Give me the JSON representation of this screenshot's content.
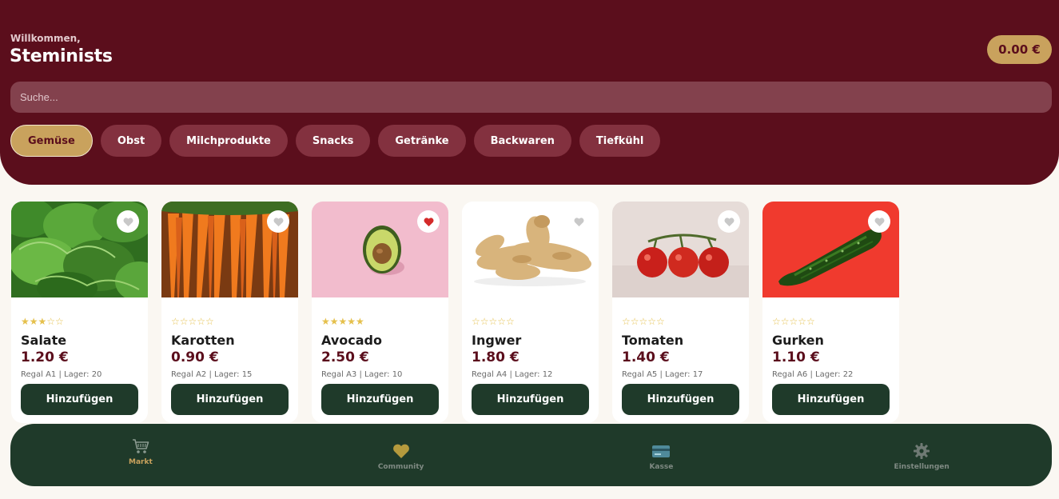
{
  "header": {
    "welcome": "Willkommen,",
    "username": "Steminists",
    "balance": "0.00 €"
  },
  "search": {
    "placeholder": "Suche..."
  },
  "categories": [
    {
      "label": "Gemüse",
      "active": true
    },
    {
      "label": "Obst",
      "active": false
    },
    {
      "label": "Milchprodukte",
      "active": false
    },
    {
      "label": "Snacks",
      "active": false
    },
    {
      "label": "Getränke",
      "active": false
    },
    {
      "label": "Backwaren",
      "active": false
    },
    {
      "label": "Tiefkühl",
      "active": false
    }
  ],
  "products": [
    {
      "name": "Salate",
      "price": "1.20 €",
      "stars": "★★★☆☆",
      "meta": "Regal A1 | Lager: 20",
      "button": "Hinzufügen",
      "favorite": false,
      "image": "lettuce"
    },
    {
      "name": "Karotten",
      "price": "0.90 €",
      "stars": "☆☆☆☆☆",
      "meta": "Regal A2 | Lager: 15",
      "button": "Hinzufügen",
      "favorite": false,
      "image": "carrots"
    },
    {
      "name": "Avocado",
      "price": "2.50 €",
      "stars": "★★★★★",
      "meta": "Regal A3 | Lager: 10",
      "button": "Hinzufügen",
      "favorite": true,
      "image": "avocado"
    },
    {
      "name": "Ingwer",
      "price": "1.80 €",
      "stars": "☆☆☆☆☆",
      "meta": "Regal A4 | Lager: 12",
      "button": "Hinzufügen",
      "favorite": false,
      "image": "ginger"
    },
    {
      "name": "Tomaten",
      "price": "1.40 €",
      "stars": "☆☆☆☆☆",
      "meta": "Regal A5 | Lager: 17",
      "button": "Hinzufügen",
      "favorite": false,
      "image": "tomatoes"
    },
    {
      "name": "Gurken",
      "price": "1.10 €",
      "stars": "☆☆☆☆☆",
      "meta": "Regal A6 | Lager: 22",
      "button": "Hinzufügen",
      "favorite": false,
      "image": "cucumber"
    }
  ],
  "nav": [
    {
      "label": "Markt",
      "icon": "cart-icon",
      "active": true
    },
    {
      "label": "Community",
      "icon": "heart-icon",
      "active": false
    },
    {
      "label": "Kasse",
      "icon": "card-icon",
      "active": false
    },
    {
      "label": "Einstellungen",
      "icon": "gear-icon",
      "active": false
    }
  ],
  "colors": {
    "brand": "#5b0e1c",
    "accent": "#c9a25d",
    "dark_green": "#1f3a2a",
    "star": "#e5c04c",
    "favorite": "#d42a2a"
  }
}
